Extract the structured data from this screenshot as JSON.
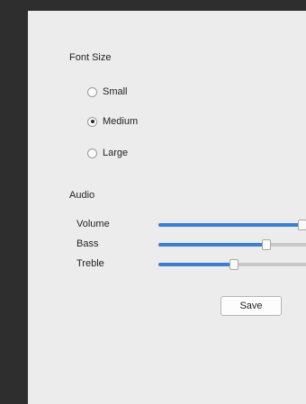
{
  "font_size": {
    "title": "Font Size",
    "options": [
      {
        "label": "Small",
        "checked": false
      },
      {
        "label": "Medium",
        "checked": true
      },
      {
        "label": "Large",
        "checked": false
      }
    ]
  },
  "audio": {
    "title": "Audio",
    "sliders": [
      {
        "label": "Volume",
        "value": 0.8
      },
      {
        "label": "Bass",
        "value": 0.6
      },
      {
        "label": "Treble",
        "value": 0.42
      }
    ]
  },
  "save_label": "Save",
  "colors": {
    "background": "#2e2e2e",
    "panel": "#ececec",
    "accent": "#3b7fd0"
  }
}
